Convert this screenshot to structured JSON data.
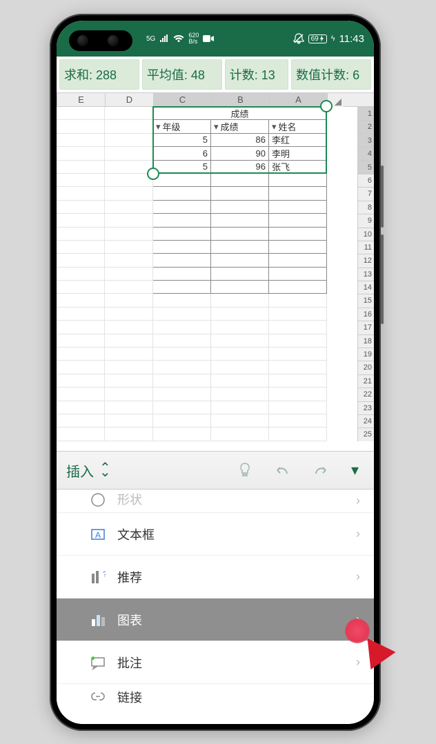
{
  "statusbar": {
    "network_label": "5G",
    "speed_top": "620",
    "speed_bot": "B/s",
    "battery": "69",
    "time": "11:43"
  },
  "stats": {
    "sum_label": "求和: 288",
    "avg_label": "平均值: 48",
    "count_label": "计数: 13",
    "numcount_label": "数值计数: 6"
  },
  "sheet": {
    "columns": [
      "E",
      "D",
      "C",
      "B",
      "A"
    ],
    "row_numbers": [
      1,
      2,
      3,
      4,
      5,
      6,
      7,
      8,
      9,
      10,
      11,
      12,
      13,
      14,
      15,
      16,
      17,
      18,
      19,
      20,
      21,
      22,
      23,
      24,
      25
    ],
    "merged_title": "成绩",
    "headers": {
      "C": "年级",
      "B": "成绩",
      "A": "姓名"
    },
    "data_rows": [
      {
        "C": "5",
        "B": "86",
        "A": "李红"
      },
      {
        "C": "6",
        "B": "90",
        "A": "李明"
      },
      {
        "C": "5",
        "B": "96",
        "A": "张飞"
      }
    ],
    "selection": {
      "top_cell": "A1-C5"
    }
  },
  "toolbar": {
    "label": "插入"
  },
  "menu": {
    "item_partial_top": "形状",
    "items": [
      {
        "label": "文本框",
        "icon": "textbox"
      },
      {
        "label": "推荐",
        "icon": "recommend"
      },
      {
        "label": "图表",
        "icon": "chart",
        "selected": true
      },
      {
        "label": "批注",
        "icon": "comment"
      }
    ],
    "item_partial_bot": "链接"
  }
}
